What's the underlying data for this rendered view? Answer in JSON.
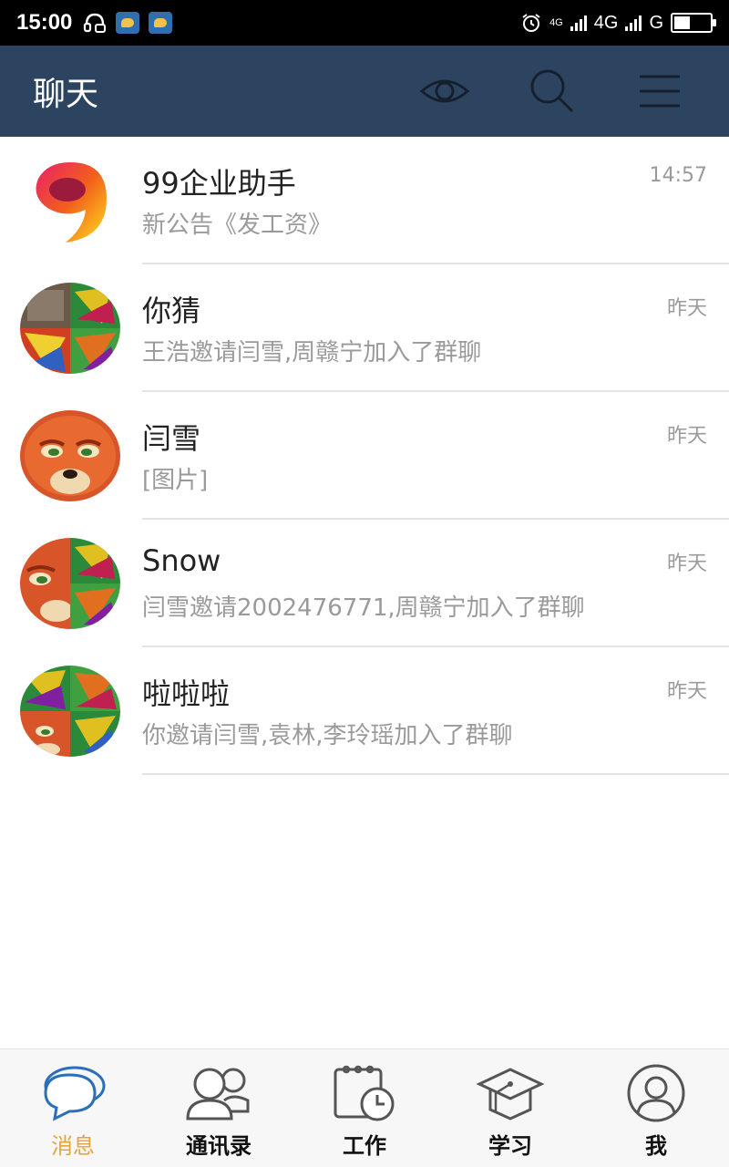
{
  "status_bar": {
    "time": "15:00",
    "network_1": "4G",
    "network_small": "4G",
    "network_2": "G",
    "battery_level": 0.45
  },
  "header": {
    "title": "聊天",
    "eye_icon": "eye-icon",
    "search_icon": "search-icon",
    "menu_icon": "menu-icon"
  },
  "chats": [
    {
      "name": "99企业助手",
      "preview": "新公告《发工资》",
      "time": "14:57",
      "avatar": "app-logo"
    },
    {
      "name": "你猜",
      "preview": "王浩邀请闫雪,周赣宁加入了群聊",
      "time": "昨天",
      "avatar": "group-collage"
    },
    {
      "name": "闫雪",
      "preview": "[图片]",
      "time": "昨天",
      "avatar": "fox-photo"
    },
    {
      "name": "Snow",
      "preview": "闫雪邀请2002476771,周赣宁加入了群聊",
      "time": "昨天",
      "avatar": "group-collage"
    },
    {
      "name": "啦啦啦",
      "preview": "你邀请闫雪,袁林,李玲瑶加入了群聊",
      "time": "昨天",
      "avatar": "group-collage"
    }
  ],
  "bottom_nav": [
    {
      "label": "消息",
      "icon": "chat-bubbles-icon",
      "active": true
    },
    {
      "label": "通讯录",
      "icon": "contacts-icon",
      "active": false
    },
    {
      "label": "工作",
      "icon": "calendar-clock-icon",
      "active": false
    },
    {
      "label": "学习",
      "icon": "graduation-cap-icon",
      "active": false
    },
    {
      "label": "我",
      "icon": "profile-icon",
      "active": false
    }
  ],
  "colors": {
    "header_bg": "#2d4460",
    "active_tab": "#e8a33a",
    "text_primary": "#222222",
    "text_secondary": "#9a9a9a"
  }
}
